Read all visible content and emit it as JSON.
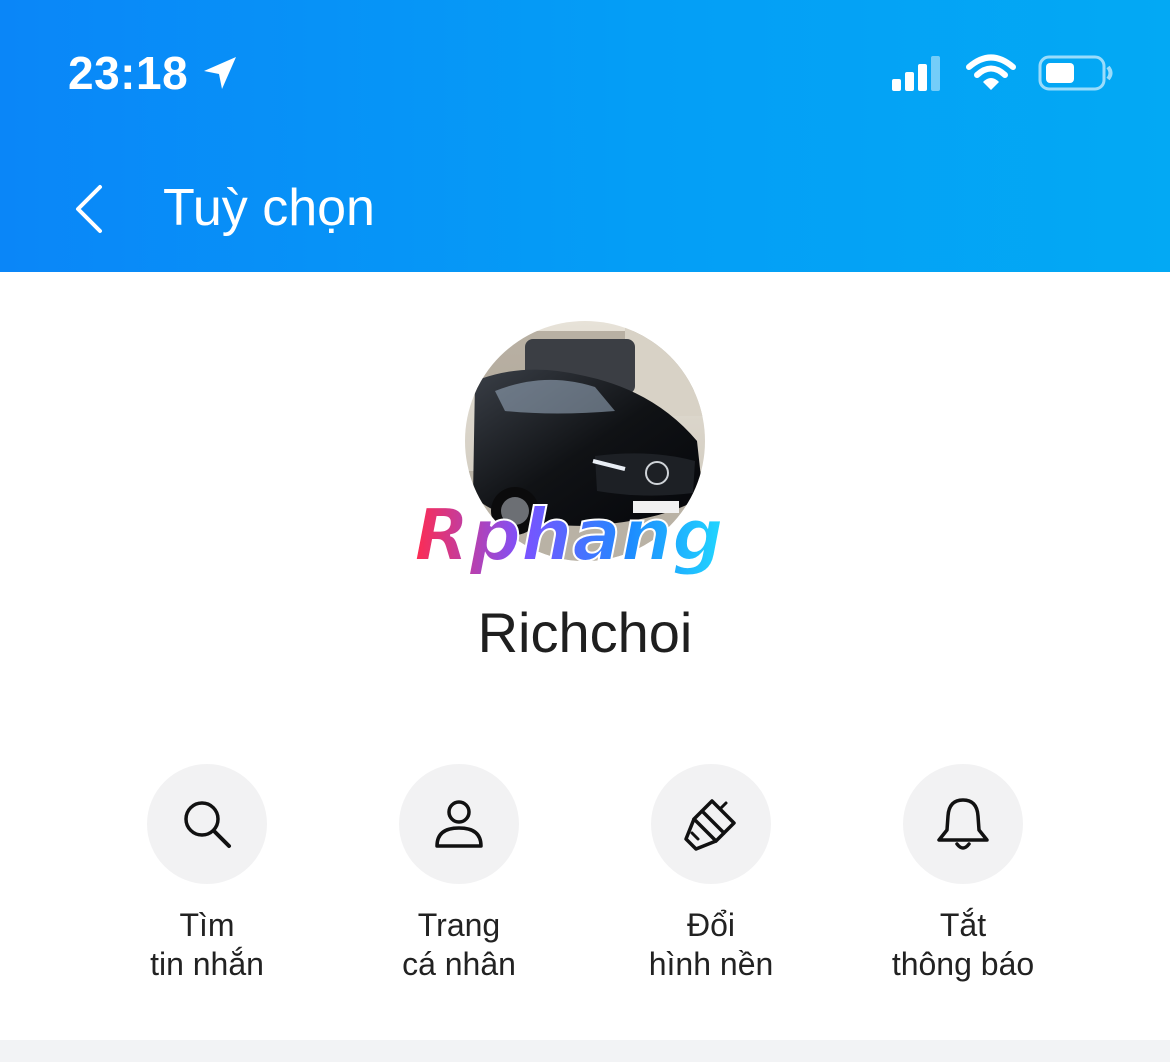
{
  "status_bar": {
    "time": "23:18",
    "icons": [
      "location-arrow-icon",
      "cellular-signal-icon",
      "wifi-icon",
      "battery-icon"
    ]
  },
  "nav": {
    "back_icon": "chevron-left-icon",
    "title": "Tuỳ chọn"
  },
  "profile": {
    "name": "Richchoi",
    "avatar": "black-car-photo",
    "watermark": "Rphang"
  },
  "actions": [
    {
      "icon": "search-icon",
      "line1": "Tìm",
      "line2": "tin nhắn"
    },
    {
      "icon": "user-icon",
      "line1": "Trang",
      "line2": "cá nhân"
    },
    {
      "icon": "paintbrush-icon",
      "line1": "Đổi",
      "line2": "hình nền"
    },
    {
      "icon": "bell-icon",
      "line1": "Tắt",
      "line2": "thông báo"
    }
  ],
  "colors": {
    "header_start": "#0a86f8",
    "header_end": "#03a9f4",
    "action_circle": "#f2f2f3",
    "text": "#1f1f1f"
  }
}
